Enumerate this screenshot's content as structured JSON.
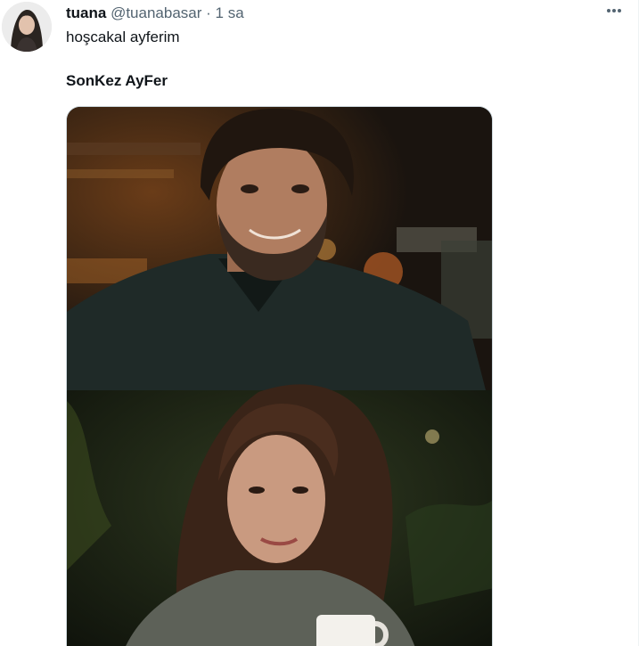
{
  "tweet": {
    "display_name": "tuana",
    "handle": "@tuanabasar",
    "separator": "·",
    "time": "1 sa",
    "text": "hoşcakal ayferim",
    "title": "SonKez AyFer"
  },
  "icons": {
    "more": "more-horizontal-icon"
  },
  "colors": {
    "text_primary": "#0f1419",
    "text_secondary": "#536471",
    "border": "#cfd9de"
  }
}
